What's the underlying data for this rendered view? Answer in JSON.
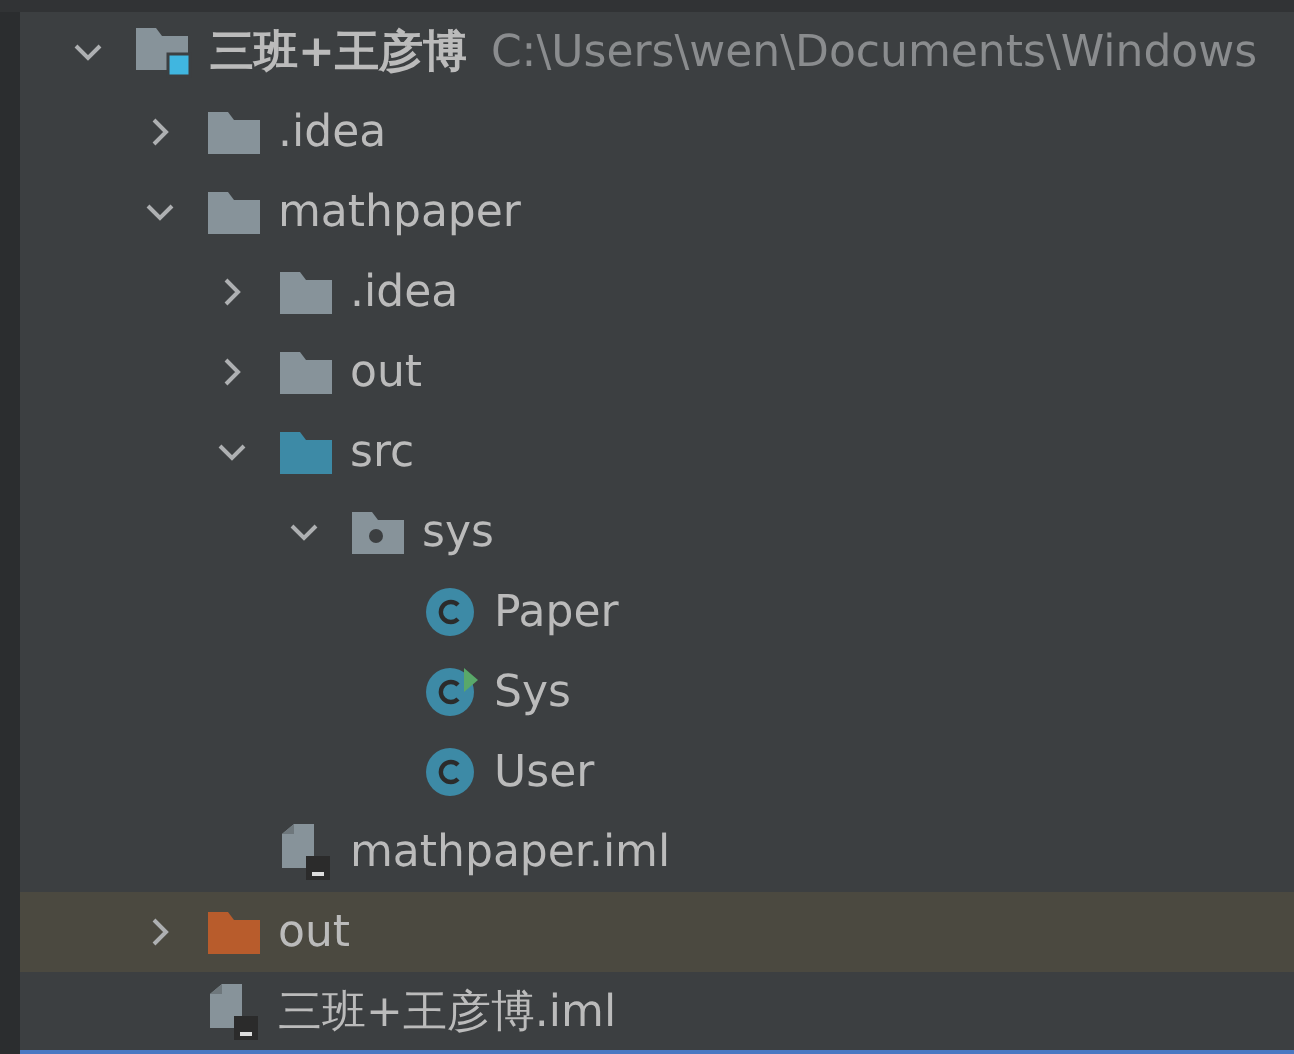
{
  "tree": [
    {
      "name": "三班+王彦博",
      "path": "C:\\Users\\wen\\Documents\\Windows",
      "kind": "project",
      "expanded": true,
      "selected": false,
      "children": [
        {
          "name": ".idea",
          "kind": "folder",
          "expanded": false,
          "selected": false
        },
        {
          "name": "mathpaper",
          "kind": "folder",
          "expanded": true,
          "selected": false,
          "children": [
            {
              "name": ".idea",
              "kind": "folder",
              "expanded": false,
              "selected": false
            },
            {
              "name": "out",
              "kind": "folder",
              "expanded": false,
              "selected": false
            },
            {
              "name": "src",
              "kind": "source-folder",
              "expanded": true,
              "selected": false,
              "children": [
                {
                  "name": "sys",
                  "kind": "package",
                  "expanded": true,
                  "selected": false,
                  "children": [
                    {
                      "name": "Paper",
                      "kind": "class",
                      "selected": false
                    },
                    {
                      "name": "Sys",
                      "kind": "main-class",
                      "selected": false
                    },
                    {
                      "name": "User",
                      "kind": "class",
                      "selected": false
                    }
                  ]
                }
              ]
            },
            {
              "name": "mathpaper.iml",
              "kind": "module-file",
              "selected": false
            }
          ]
        },
        {
          "name": "out",
          "kind": "excluded-folder",
          "expanded": false,
          "selected": true
        },
        {
          "name": "三班+王彦博.iml",
          "kind": "module-file",
          "selected": false
        }
      ]
    }
  ]
}
